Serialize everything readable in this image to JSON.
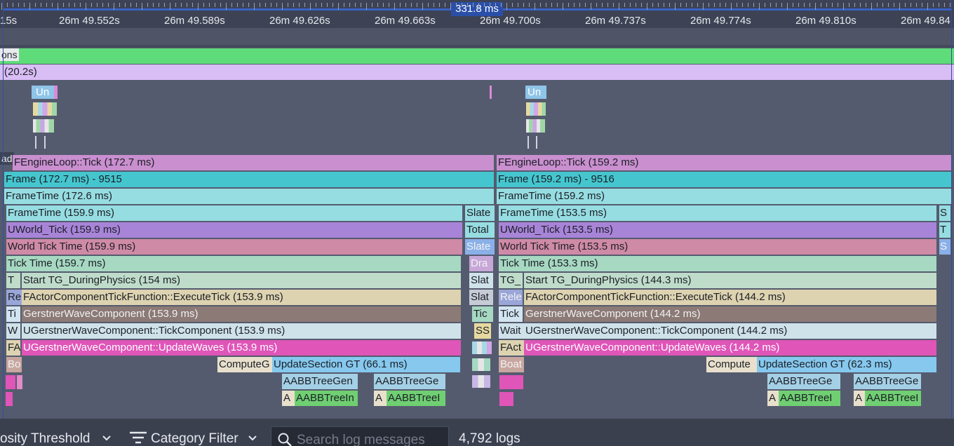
{
  "ruler": {
    "labels": [
      "15s",
      "26m 49.552s",
      "26m 49.589s",
      "26m 49.626s",
      "26m 49.663s",
      "26m 49.700s",
      "26m 49.737s",
      "26m 49.774s",
      "26m 49.810s",
      "26m 49.84"
    ],
    "selection": "331.8 ms"
  },
  "tracks": {
    "green_label": "ons",
    "purple_label": "(20.2s)",
    "ue_marker_a": "Un",
    "ue_marker_b": "Un",
    "thread_stub": "ad"
  },
  "timeline": {
    "frame1": {
      "engine_loop": "FEngineLoop::Tick (172.7 ms)",
      "frame": "Frame (172.7 ms) -  9515",
      "frame_time_outer": "FrameTime (172.6 ms)",
      "frame_time": "FrameTime (159.9 ms)",
      "uworld_tick": "UWorld_Tick (159.9 ms)",
      "world_tick_time": "World Tick Time (159.9 ms)",
      "tick_time": "Tick Time (159.7 ms)",
      "tg_during_physics": "Start TG_DuringPhysics (154 ms)",
      "execute_tick": "FActorComponentTickFunction::ExecuteTick (153.9 ms)",
      "gerstner": "GerstnerWaveComponent (153.9 ms)",
      "tick_component": "UGerstnerWaveComponent::TickComponent (153.9 ms)",
      "update_waves": "UGerstnerWaveComponent::UpdateWaves (153.9 ms)",
      "compute": "ComputeG",
      "update_section": "UpdateSection GT (66.1 ms)",
      "aabb1": "AABBTreeGen",
      "aabb2": "AABBTreeGe",
      "aabb3": "AABBTreeIn",
      "aabb4": "AABBTreeI",
      "a1": "A",
      "a2": "A",
      "stub_t": "T",
      "stub_re": "Re",
      "stub_ti": "Ti",
      "stub_w": "W",
      "stub_fa": "FA",
      "stub_bo": "Bo"
    },
    "mid": {
      "slate": "Slate",
      "total": "Total",
      "slate2": "Slate",
      "dra": "Dra",
      "slat": "Slat",
      "slat2": "Slat",
      "tic": "Tic",
      "ss": "SS"
    },
    "frame2": {
      "engine_loop": "FEngineLoop::Tick (159.2 ms)",
      "frame": "Frame (159.2 ms) -  9516",
      "frame_time_outer": "FrameTime (159.2 ms)",
      "frame_time": "FrameTime (153.5 ms)",
      "uworld_tick": "UWorld_Tick (153.5 ms)",
      "world_tick_time": "World Tick Time (153.5 ms)",
      "tick_time": "Tick Time (153.3 ms)",
      "tg_stub": "TG_",
      "tg_during_physics": "Start TG_DuringPhysics (144.3 ms)",
      "rele": "Rele",
      "execute_tick": "FActorComponentTickFunction::ExecuteTick (144.2 ms)",
      "tick": "Tick",
      "gerstner": "GerstnerWaveComponent (144.2 ms)",
      "wait": "Wait",
      "tick_component": "UGerstnerWaveComponent::TickComponent (144.2 ms)",
      "fact": "FAct",
      "update_waves": "UGerstnerWaveComponent::UpdateWaves (144.2 ms)",
      "boat": "Boat",
      "compute": "Compute",
      "update_section": "UpdateSection GT (62.3 ms)",
      "aabb1": "AABBTreeGe",
      "aabb2": "AABBTreeGe",
      "aabb3": "AABBTreeI",
      "aabb4": "AABBTreeI",
      "a1": "A",
      "a2": "A",
      "s1": "S",
      "t1": "T",
      "s2": "S"
    }
  },
  "bottom": {
    "verbosity": "osity Threshold",
    "category_filter": "Category Filter",
    "search_placeholder": "Search log messages",
    "log_count": "4,792 logs"
  },
  "colors": {
    "ruler_bg": "#3d4354",
    "selection": "#2a4fa8",
    "engine_loop": "#c98fcf",
    "frame": "#45c6cf",
    "frame_time": "#96dde2",
    "uworld": "#a884d8",
    "world_tick": "#cf8aa6",
    "tick_time": "#a6d8c2",
    "during_physics": "#bfdcca",
    "execute_tick": "#ddd3b0",
    "gerstner": "#8b7a76",
    "tick_component": "#cfe2ea",
    "update_waves": "#df55b8",
    "update_section": "#86c8ee",
    "aabb_blue": "#a4d0e6",
    "aabb_green": "#6fcf72"
  }
}
